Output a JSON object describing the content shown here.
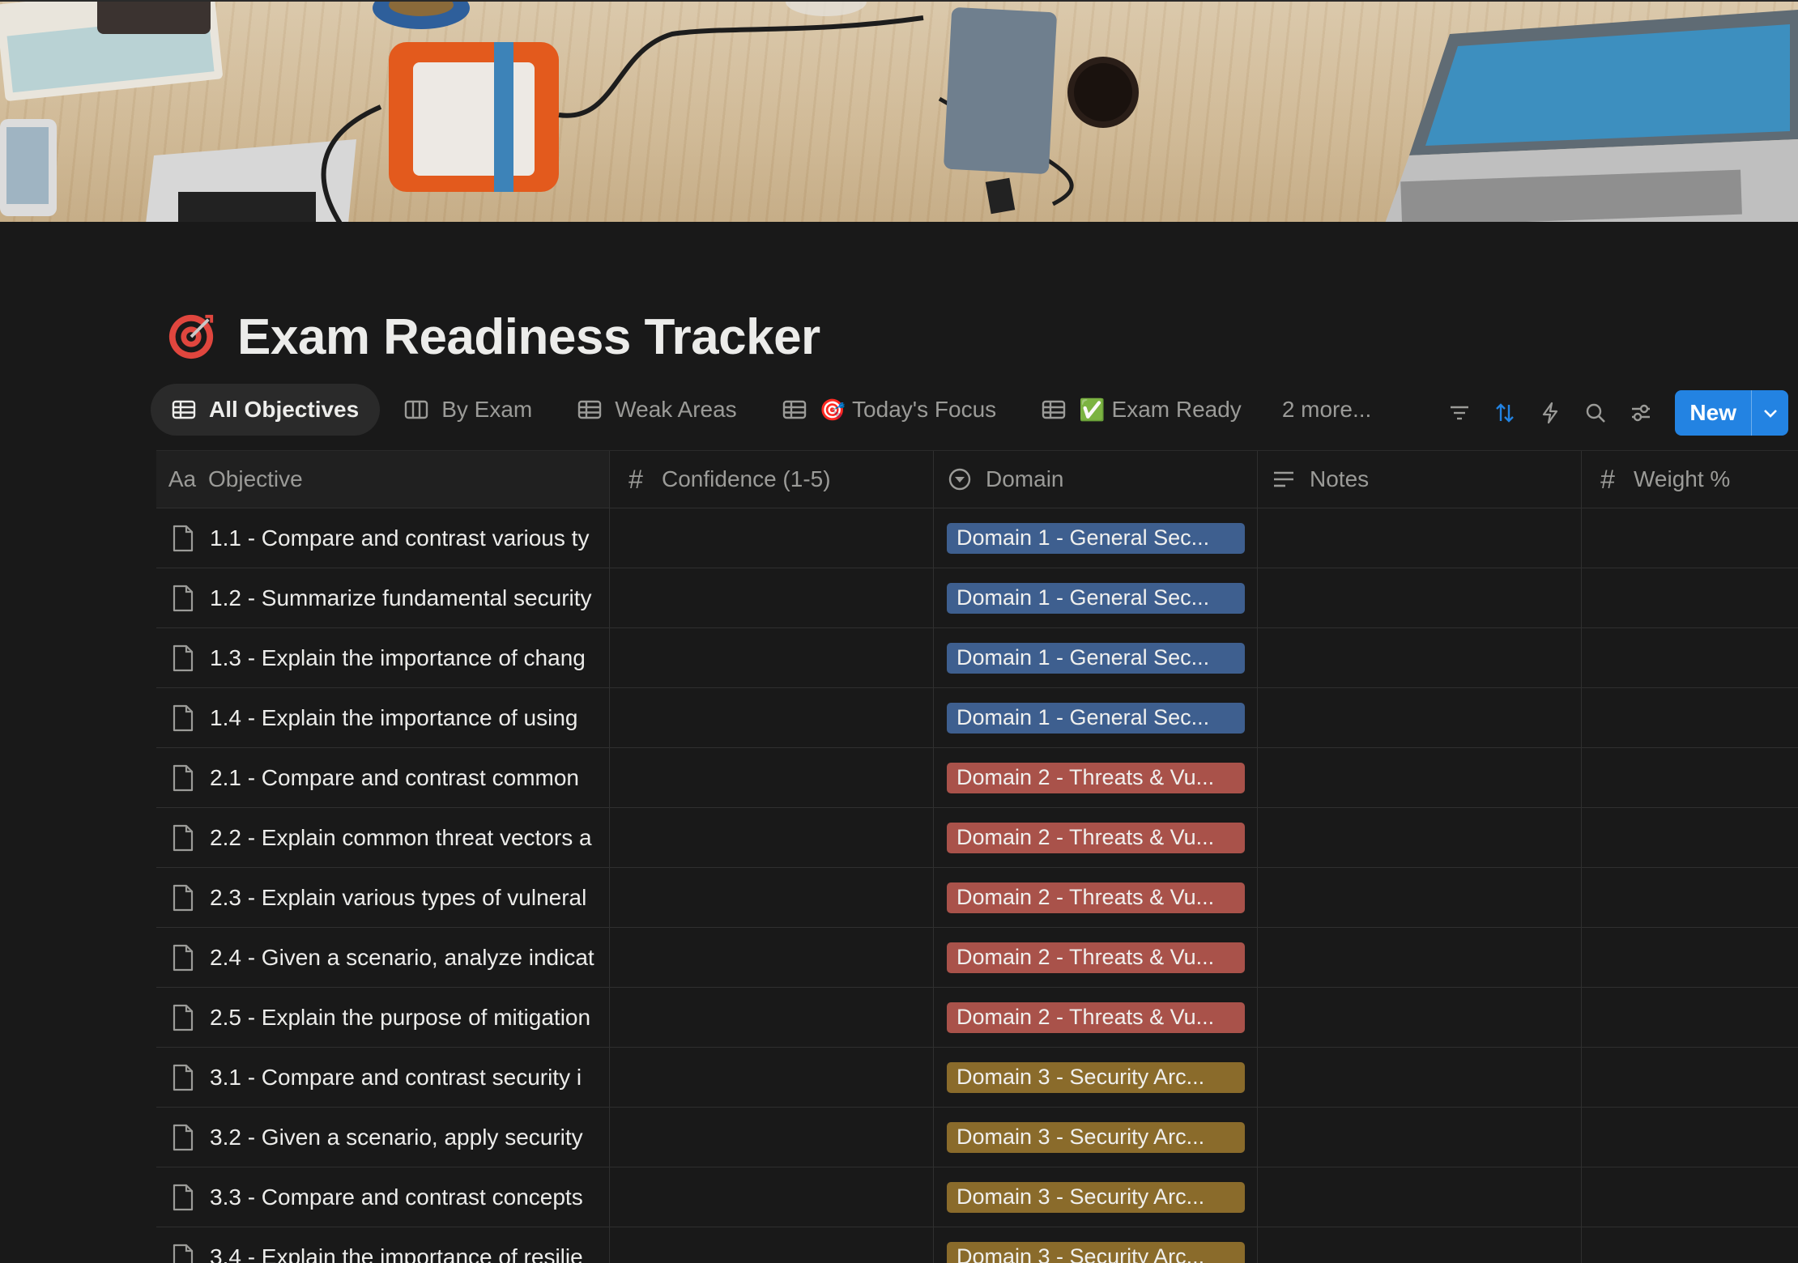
{
  "page": {
    "title": "Exam Readiness Tracker",
    "icon": "target-icon"
  },
  "views": [
    {
      "label": "All Objectives",
      "icon": "table-icon",
      "active": true
    },
    {
      "label": "By Exam",
      "icon": "board-icon"
    },
    {
      "label": "Weak Areas",
      "icon": "table-icon"
    },
    {
      "label": "Today's Focus",
      "icon": "table-icon",
      "emoji": "🎯"
    },
    {
      "label": "Exam Ready",
      "icon": "table-icon",
      "emoji": "✅"
    },
    {
      "label": "2 more..."
    }
  ],
  "toolbar": {
    "icons": [
      "filter-icon",
      "sort-icon",
      "automation-icon",
      "search-icon",
      "settings-icon"
    ],
    "new_label": "New"
  },
  "columns": [
    {
      "label": "Objective",
      "icon": "Aa"
    },
    {
      "label": "Confidence (1-5)",
      "icon": "#"
    },
    {
      "label": "Domain",
      "icon": "select-icon"
    },
    {
      "label": "Notes",
      "icon": "text-icon"
    },
    {
      "label": "Weight %",
      "icon": "#"
    }
  ],
  "colors": {
    "domain1": "#3e5f8f",
    "domain2": "#a9524a",
    "domain3": "#8a6b2b",
    "accent": "#2383e2"
  },
  "rows": [
    {
      "objective": "1.1 - Compare and contrast various ty",
      "domain": "Domain 1 - General Sec...",
      "d": 1
    },
    {
      "objective": "1.2 - Summarize fundamental security",
      "domain": "Domain 1 - General Sec...",
      "d": 1
    },
    {
      "objective": "1.3 - Explain the importance of chang",
      "domain": "Domain 1 - General Sec...",
      "d": 1
    },
    {
      "objective": "1.4 - Explain the importance of using",
      "domain": "Domain 1 - General Sec...",
      "d": 1
    },
    {
      "objective": "2.1 - Compare and contrast common",
      "domain": "Domain 2 - Threats & Vu...",
      "d": 2
    },
    {
      "objective": "2.2 - Explain common threat vectors a",
      "domain": "Domain 2 - Threats & Vu...",
      "d": 2
    },
    {
      "objective": "2.3 - Explain various types of vulneral",
      "domain": "Domain 2 - Threats & Vu...",
      "d": 2
    },
    {
      "objective": "2.4 - Given a scenario, analyze indicat",
      "domain": "Domain 2 - Threats & Vu...",
      "d": 2
    },
    {
      "objective": "2.5 - Explain the purpose of mitigation",
      "domain": "Domain 2 - Threats & Vu...",
      "d": 2
    },
    {
      "objective": "3.1 - Compare and contrast security i",
      "domain": "Domain 3 - Security Arc...",
      "d": 3
    },
    {
      "objective": "3.2 - Given a scenario, apply security",
      "domain": "Domain 3 - Security Arc...",
      "d": 3
    },
    {
      "objective": "3.3 - Compare and contrast concepts",
      "domain": "Domain 3 - Security Arc...",
      "d": 3
    },
    {
      "objective": "3.4 - Explain the importance of resilie",
      "domain": "Domain 3 - Security Arc...",
      "d": 3
    }
  ]
}
